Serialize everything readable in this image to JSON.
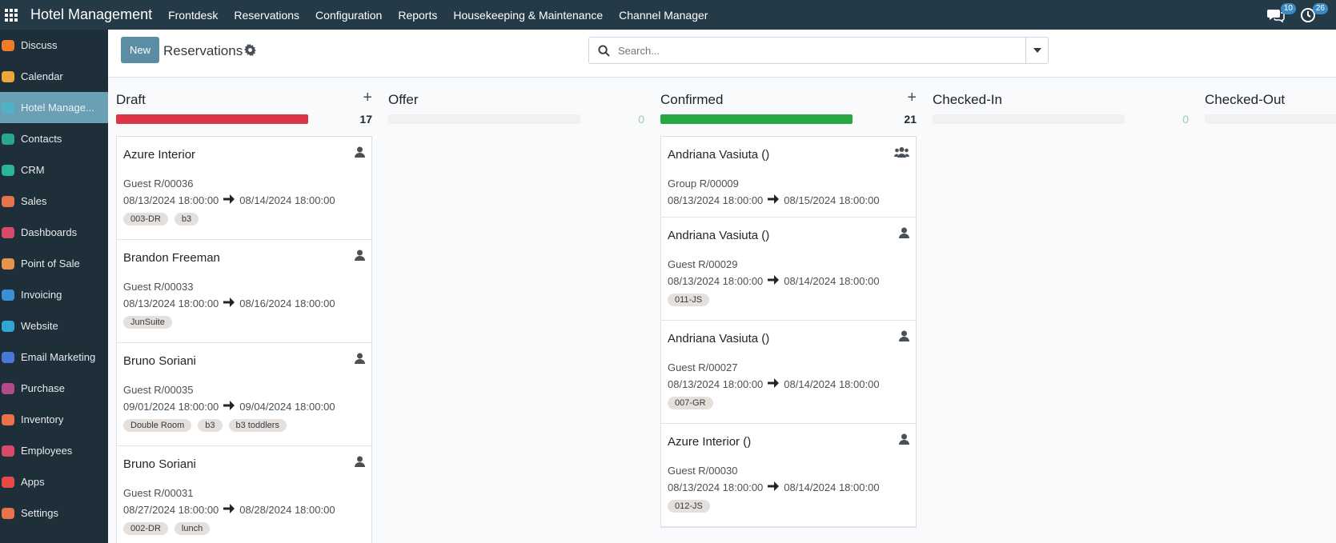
{
  "topbar": {
    "brand": "Hotel Management",
    "menu": [
      "Frontdesk",
      "Reservations",
      "Configuration",
      "Reports",
      "Housekeeping & Maintenance",
      "Channel Manager"
    ],
    "messages_count": "10",
    "activities_count": "26"
  },
  "sidebar": {
    "items": [
      {
        "label": "Discuss",
        "icon": "discuss-icon",
        "color": "#f07c2a"
      },
      {
        "label": "Calendar",
        "icon": "calendar-icon",
        "color": "#f0a73a"
      },
      {
        "label": "Hotel Manage...",
        "icon": "hotel-icon",
        "color": "#4fb3c7",
        "active": true
      },
      {
        "label": "Contacts",
        "icon": "contacts-icon",
        "color": "#2aa58f"
      },
      {
        "label": "CRM",
        "icon": "crm-icon",
        "color": "#2bb59a"
      },
      {
        "label": "Sales",
        "icon": "sales-icon",
        "color": "#e8734a"
      },
      {
        "label": "Dashboards",
        "icon": "dashboards-icon",
        "color": "#d94a6a"
      },
      {
        "label": "Point of Sale",
        "icon": "pos-icon",
        "color": "#e8934a"
      },
      {
        "label": "Invoicing",
        "icon": "invoicing-icon",
        "color": "#3a8fd9"
      },
      {
        "label": "Website",
        "icon": "website-icon",
        "color": "#2fa7d3"
      },
      {
        "label": "Email Marketing",
        "icon": "email-marketing-icon",
        "color": "#4a78d9"
      },
      {
        "label": "Purchase",
        "icon": "purchase-icon",
        "color": "#b54a8a"
      },
      {
        "label": "Inventory",
        "icon": "inventory-icon",
        "color": "#e8734a"
      },
      {
        "label": "Employees",
        "icon": "employees-icon",
        "color": "#d94a6a"
      },
      {
        "label": "Apps",
        "icon": "apps-icon",
        "color": "#e84a4a"
      },
      {
        "label": "Settings",
        "icon": "settings-icon",
        "color": "#e8734a"
      }
    ]
  },
  "control": {
    "new_label": "New",
    "title": "Reservations",
    "search_placeholder": "Search..."
  },
  "columns": [
    {
      "title": "Draft",
      "count": "17",
      "fill_fraction": 1.0,
      "color": "#dc3545",
      "has_add": true,
      "cards": [
        {
          "name": "Azure Interior",
          "ref": "Guest R/00036",
          "from": "08/13/2024 18:00:00",
          "to": "08/14/2024 18:00:00",
          "tags": [
            "003-DR",
            "b3"
          ],
          "group": false
        },
        {
          "name": "Brandon Freeman",
          "ref": "Guest R/00033",
          "from": "08/13/2024 18:00:00",
          "to": "08/16/2024 18:00:00",
          "tags": [
            "JunSuite"
          ],
          "group": false
        },
        {
          "name": "Bruno Soriani",
          "ref": "Guest R/00035",
          "from": "09/01/2024 18:00:00",
          "to": "09/04/2024 18:00:00",
          "tags": [
            "Double Room",
            "b3",
            "b3 toddlers"
          ],
          "group": false
        },
        {
          "name": "Bruno Soriani",
          "ref": "Guest R/00031",
          "from": "08/27/2024 18:00:00",
          "to": "08/28/2024 18:00:00",
          "tags": [
            "002-DR",
            "lunch"
          ],
          "group": false
        }
      ]
    },
    {
      "title": "Offer",
      "count": "0",
      "fill_fraction": 0,
      "color": "#28a745",
      "has_add": false,
      "cards": []
    },
    {
      "title": "Confirmed",
      "count": "21",
      "fill_fraction": 1.0,
      "color": "#28a745",
      "has_add": true,
      "cards": [
        {
          "name": "Andriana Vasiuta ()",
          "ref": "Group R/00009",
          "from": "08/13/2024 18:00:00",
          "to": "08/15/2024 18:00:00",
          "tags": [],
          "group": true
        },
        {
          "name": "Andriana Vasiuta ()",
          "ref": "Guest R/00029",
          "from": "08/13/2024 18:00:00",
          "to": "08/14/2024 18:00:00",
          "tags": [
            "011-JS"
          ],
          "group": false
        },
        {
          "name": "Andriana Vasiuta ()",
          "ref": "Guest R/00027",
          "from": "08/13/2024 18:00:00",
          "to": "08/14/2024 18:00:00",
          "tags": [
            "007-GR"
          ],
          "group": false
        },
        {
          "name": "Azure Interior ()",
          "ref": "Guest R/00030",
          "from": "08/13/2024 18:00:00",
          "to": "08/14/2024 18:00:00",
          "tags": [
            "012-JS"
          ],
          "group": false
        }
      ]
    },
    {
      "title": "Checked-In",
      "count": "0",
      "fill_fraction": 0,
      "color": "#28a745",
      "has_add": false,
      "cards": []
    },
    {
      "title": "Checked-Out",
      "count": "",
      "fill_fraction": 0,
      "color": "#28a745",
      "has_add": false,
      "cards": []
    }
  ]
}
